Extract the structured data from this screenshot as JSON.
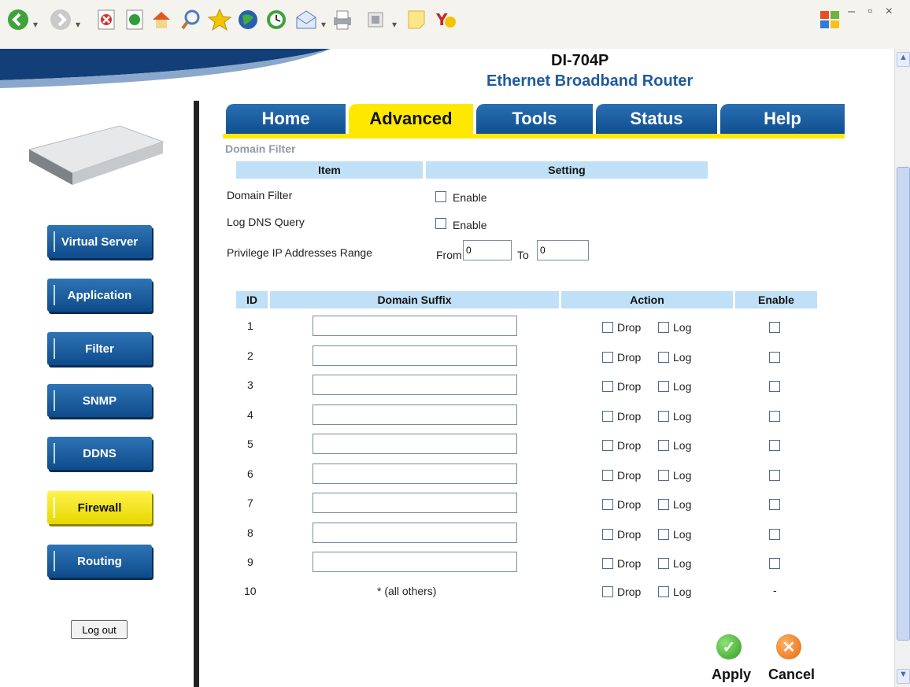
{
  "window": {
    "controls": "– ▫ ×"
  },
  "header": {
    "model": "DI-704P",
    "product": "Ethernet Broadband Router"
  },
  "tabs": [
    {
      "label": "Home",
      "active": false
    },
    {
      "label": "Advanced",
      "active": true
    },
    {
      "label": "Tools",
      "active": false
    },
    {
      "label": "Status",
      "active": false
    },
    {
      "label": "Help",
      "active": false
    }
  ],
  "sidebar": {
    "items": [
      {
        "label": "Virtual Server",
        "active": false
      },
      {
        "label": "Application",
        "active": false
      },
      {
        "label": "Filter",
        "active": false
      },
      {
        "label": "SNMP",
        "active": false
      },
      {
        "label": "DDNS",
        "active": false
      },
      {
        "label": "Firewall",
        "active": true
      },
      {
        "label": "Routing",
        "active": false
      }
    ],
    "logout": "Log out"
  },
  "section_title": "Domain Filter",
  "settings_table": {
    "headers": {
      "item": "Item",
      "setting": "Setting"
    },
    "domain_filter": {
      "label": "Domain Filter",
      "enable": "Enable"
    },
    "log_dns": {
      "label": "Log DNS Query",
      "enable": "Enable"
    },
    "privilege": {
      "label": "Privilege IP Addresses Range",
      "from": "From",
      "from_value": "0",
      "to": "To",
      "to_value": "0"
    }
  },
  "rules_table": {
    "headers": {
      "id": "ID",
      "suffix": "Domain Suffix",
      "action": "Action",
      "enable": "Enable"
    },
    "drop": "Drop",
    "log": "Log",
    "rows": [
      "1",
      "2",
      "3",
      "4",
      "5",
      "6",
      "7",
      "8",
      "9"
    ],
    "last_row": {
      "id": "10",
      "suffix": "* (all others)",
      "enable": "-"
    }
  },
  "actions": {
    "apply": "Apply",
    "cancel": "Cancel"
  }
}
